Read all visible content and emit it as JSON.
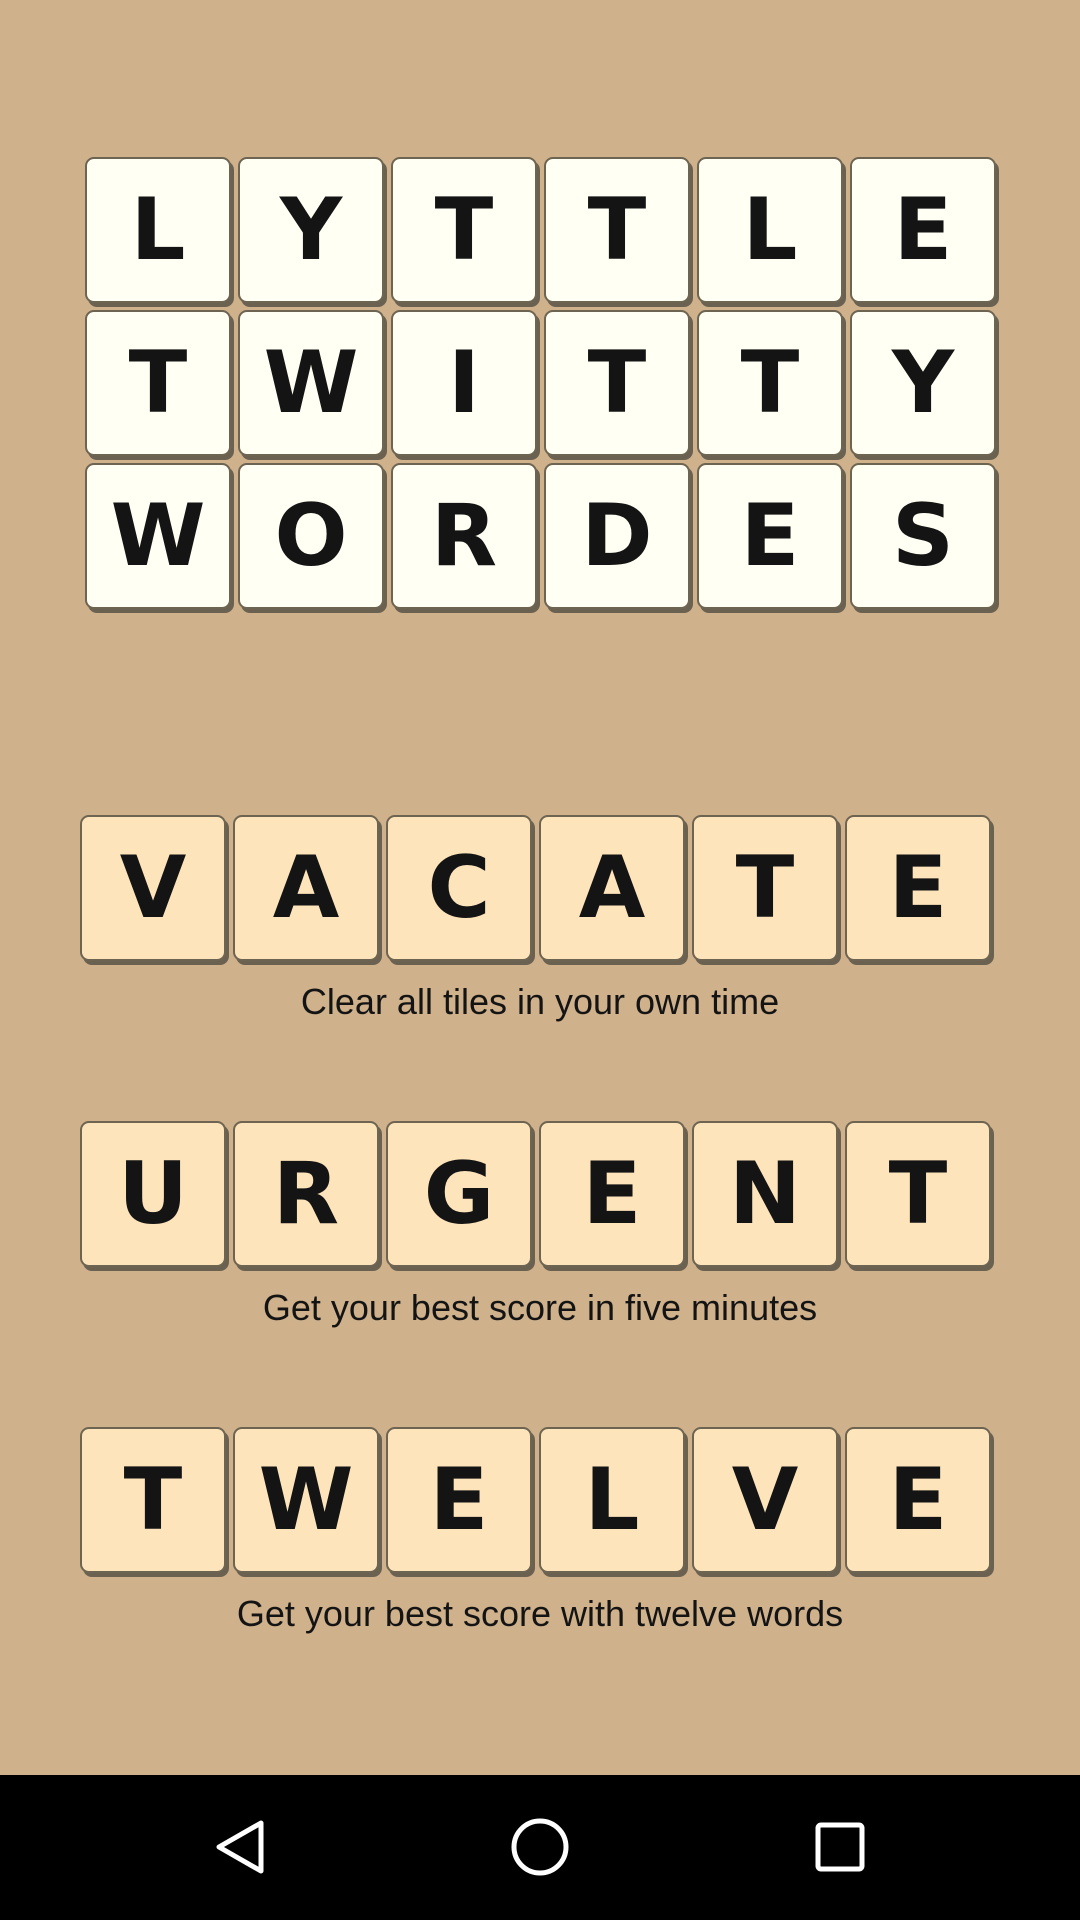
{
  "title_rows": [
    [
      "L",
      "Y",
      "T",
      "T",
      "L",
      "E"
    ],
    [
      "T",
      "W",
      "I",
      "T",
      "T",
      "Y"
    ],
    [
      "W",
      "O",
      "R",
      "D",
      "E",
      "S"
    ]
  ],
  "modes": [
    {
      "letters": [
        "V",
        "A",
        "C",
        "A",
        "T",
        "E"
      ],
      "caption": "Clear all tiles in your own time"
    },
    {
      "letters": [
        "U",
        "R",
        "G",
        "E",
        "N",
        "T"
      ],
      "caption": "Get your best score in five minutes"
    },
    {
      "letters": [
        "T",
        "W",
        "E",
        "L",
        "V",
        "E"
      ],
      "caption": "Get your best score with twelve words"
    }
  ],
  "nav": {
    "back_icon": "triangle-back-icon",
    "home_icon": "circle-home-icon",
    "recents_icon": "square-recents-icon"
  }
}
